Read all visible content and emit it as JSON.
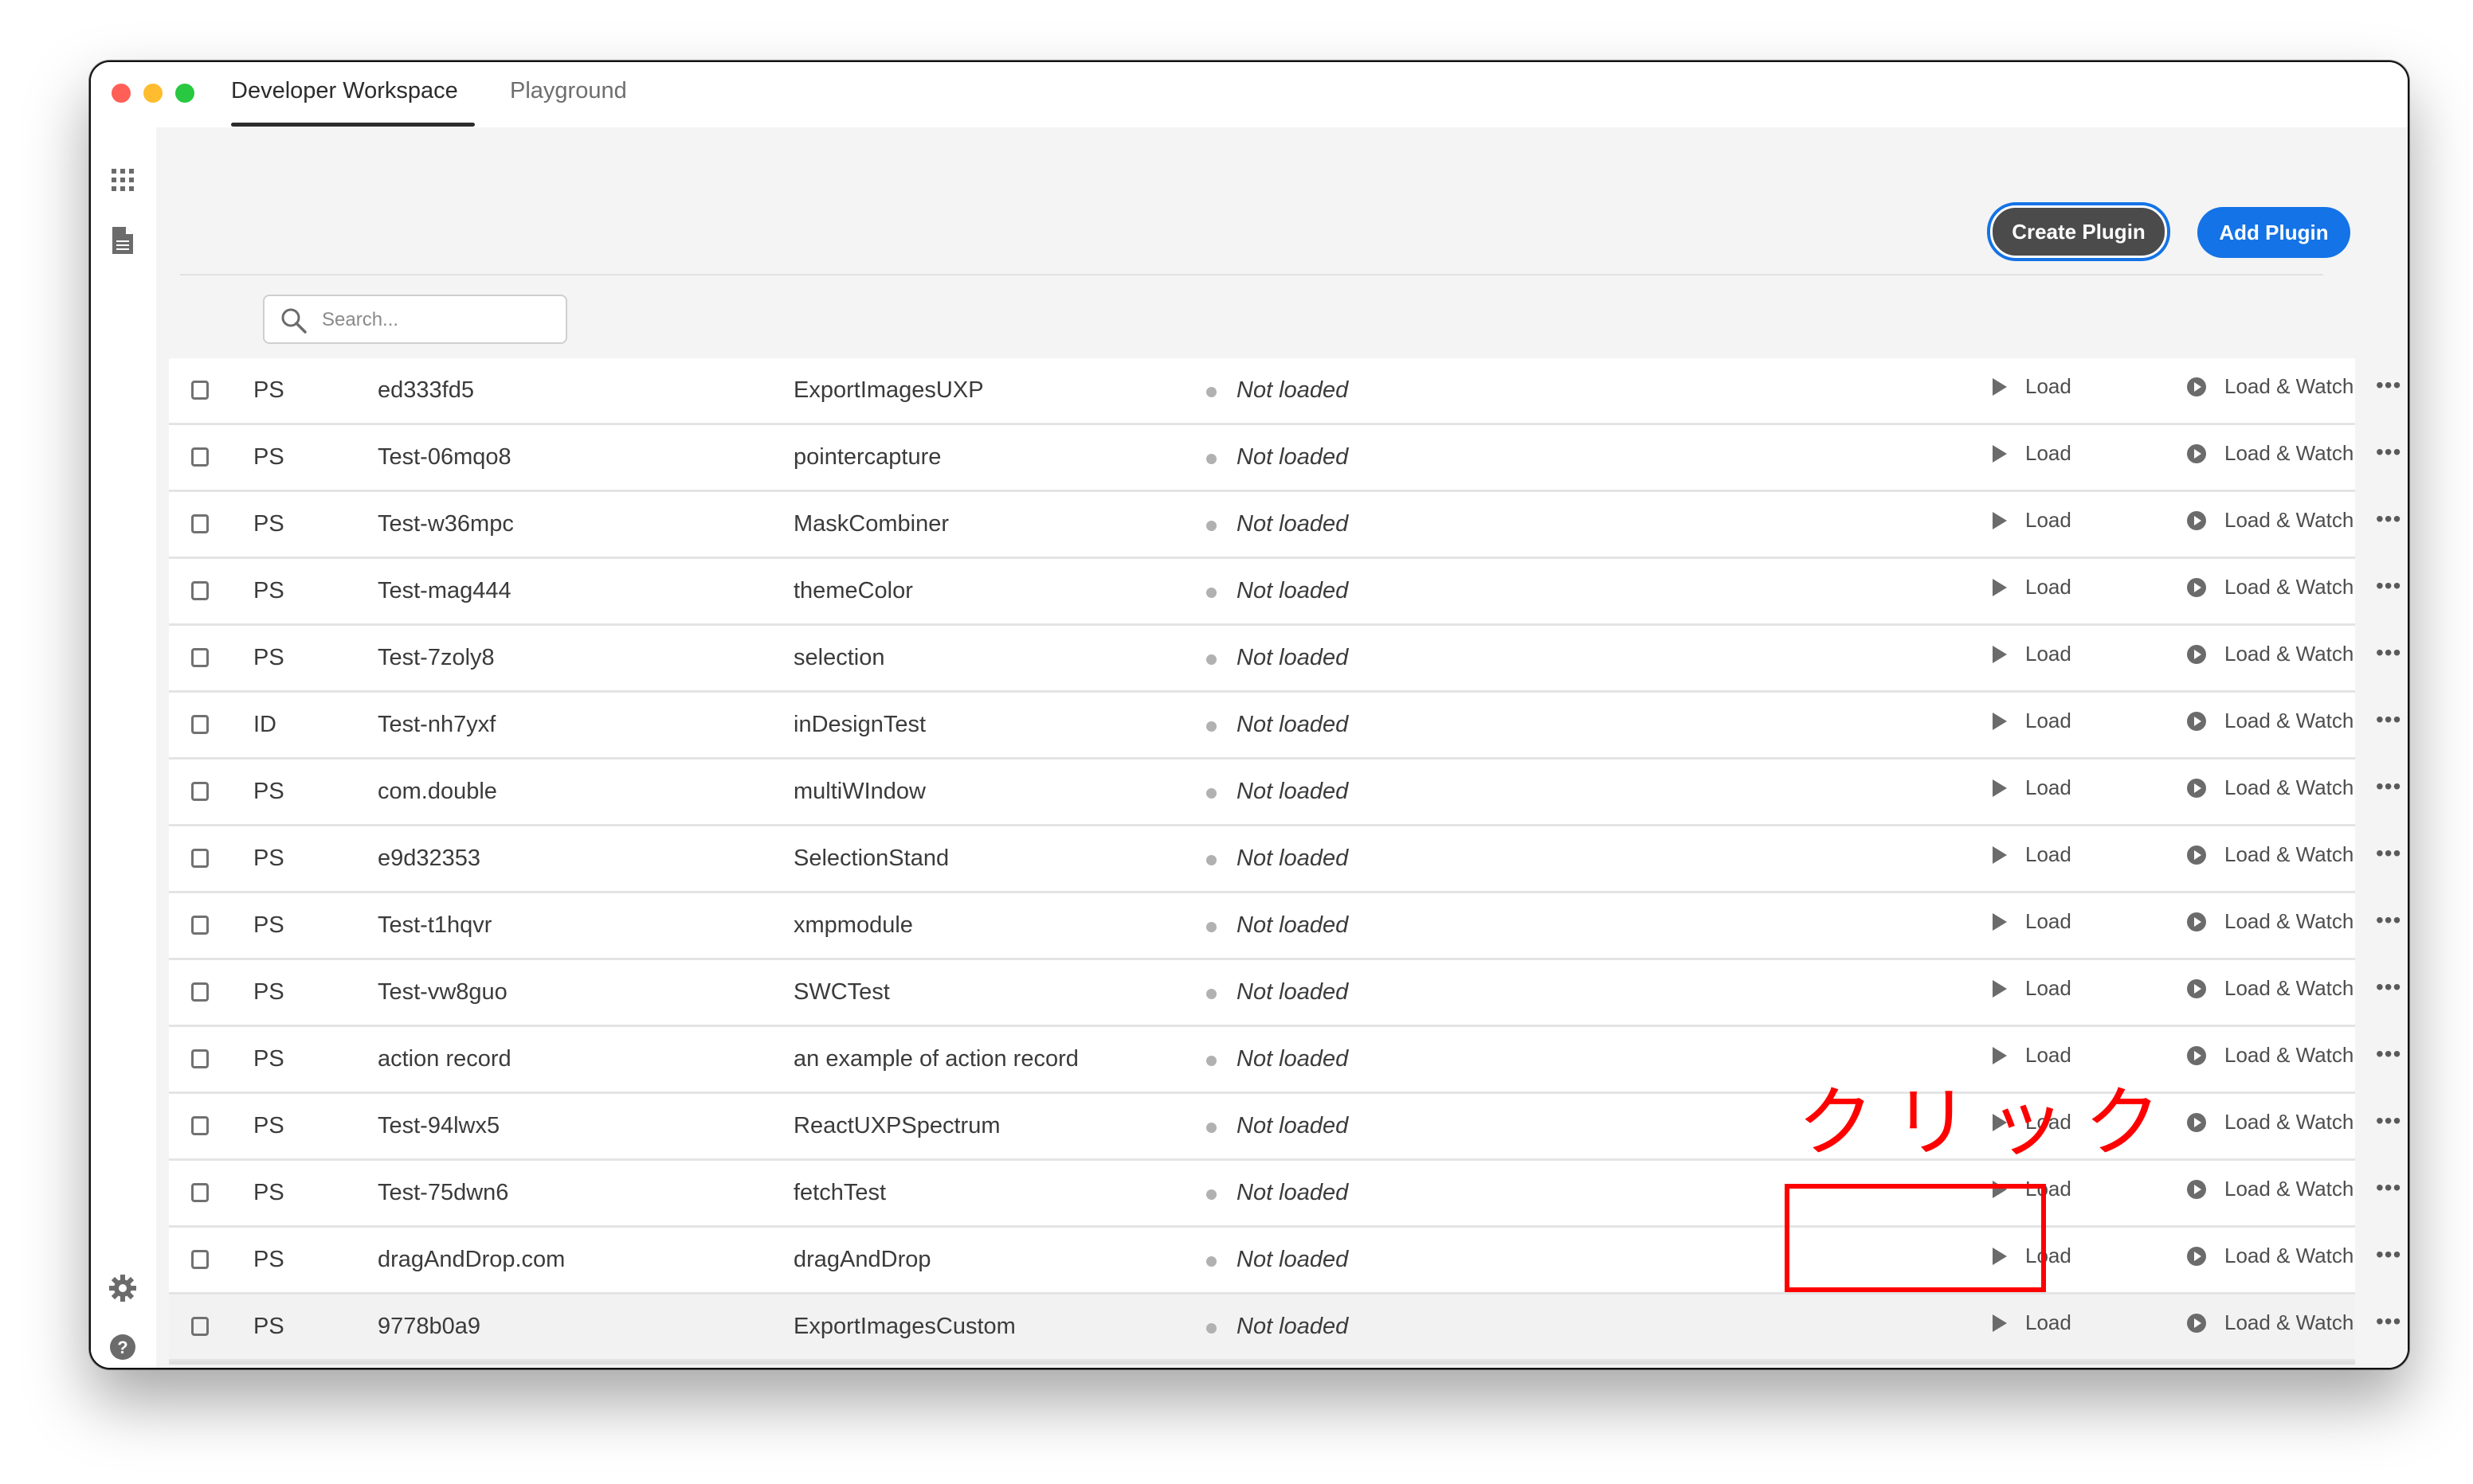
{
  "window": {
    "tabs": [
      {
        "label": "Developer Workspace",
        "active": true
      },
      {
        "label": "Playground",
        "active": false
      }
    ]
  },
  "sidebar": {
    "top_icons": [
      "grid-icon",
      "document-icon"
    ],
    "bottom_icons": [
      "gear-icon",
      "help-icon"
    ]
  },
  "toolbar": {
    "create_plugin_label": "Create Plugin",
    "add_plugin_label": "Add Plugin",
    "accent_color": "#1473e6"
  },
  "search": {
    "placeholder": "Search...",
    "value": ""
  },
  "actions": {
    "load_label": "Load",
    "load_watch_label": "Load & Watch",
    "more_label": "•••"
  },
  "plugins": [
    {
      "host": "PS",
      "id": "ed333fd5",
      "name": "ExportImagesUXP",
      "status": "Not loaded"
    },
    {
      "host": "PS",
      "id": "Test-06mqo8",
      "name": "pointercapture",
      "status": "Not loaded"
    },
    {
      "host": "PS",
      "id": "Test-w36mpc",
      "name": "MaskCombiner",
      "status": "Not loaded"
    },
    {
      "host": "PS",
      "id": "Test-mag444",
      "name": "themeColor",
      "status": "Not loaded"
    },
    {
      "host": "PS",
      "id": "Test-7zoly8",
      "name": "selection",
      "status": "Not loaded"
    },
    {
      "host": "ID",
      "id": "Test-nh7yxf",
      "name": "inDesignTest",
      "status": "Not loaded"
    },
    {
      "host": "PS",
      "id": "com.double",
      "name": "multiWIndow",
      "status": "Not loaded"
    },
    {
      "host": "PS",
      "id": "e9d32353",
      "name": "SelectionStand",
      "status": "Not loaded"
    },
    {
      "host": "PS",
      "id": "Test-t1hqvr",
      "name": "xmpmodule",
      "status": "Not loaded"
    },
    {
      "host": "PS",
      "id": "Test-vw8guo",
      "name": "SWCTest",
      "status": "Not loaded"
    },
    {
      "host": "PS",
      "id": "action record",
      "name": "an example of action record",
      "status": "Not loaded"
    },
    {
      "host": "PS",
      "id": "Test-94lwx5",
      "name": "ReactUXPSpectrum",
      "status": "Not loaded"
    },
    {
      "host": "PS",
      "id": "Test-75dwn6",
      "name": "fetchTest",
      "status": "Not loaded"
    },
    {
      "host": "PS",
      "id": "dragAndDrop.com",
      "name": "dragAndDrop",
      "status": "Not loaded"
    },
    {
      "host": "PS",
      "id": "9778b0a9",
      "name": "ExportImagesCustom",
      "status": "Not loaded",
      "highlighted": true
    }
  ],
  "annotation": {
    "text": "クリック",
    "color": "#ff0000"
  }
}
